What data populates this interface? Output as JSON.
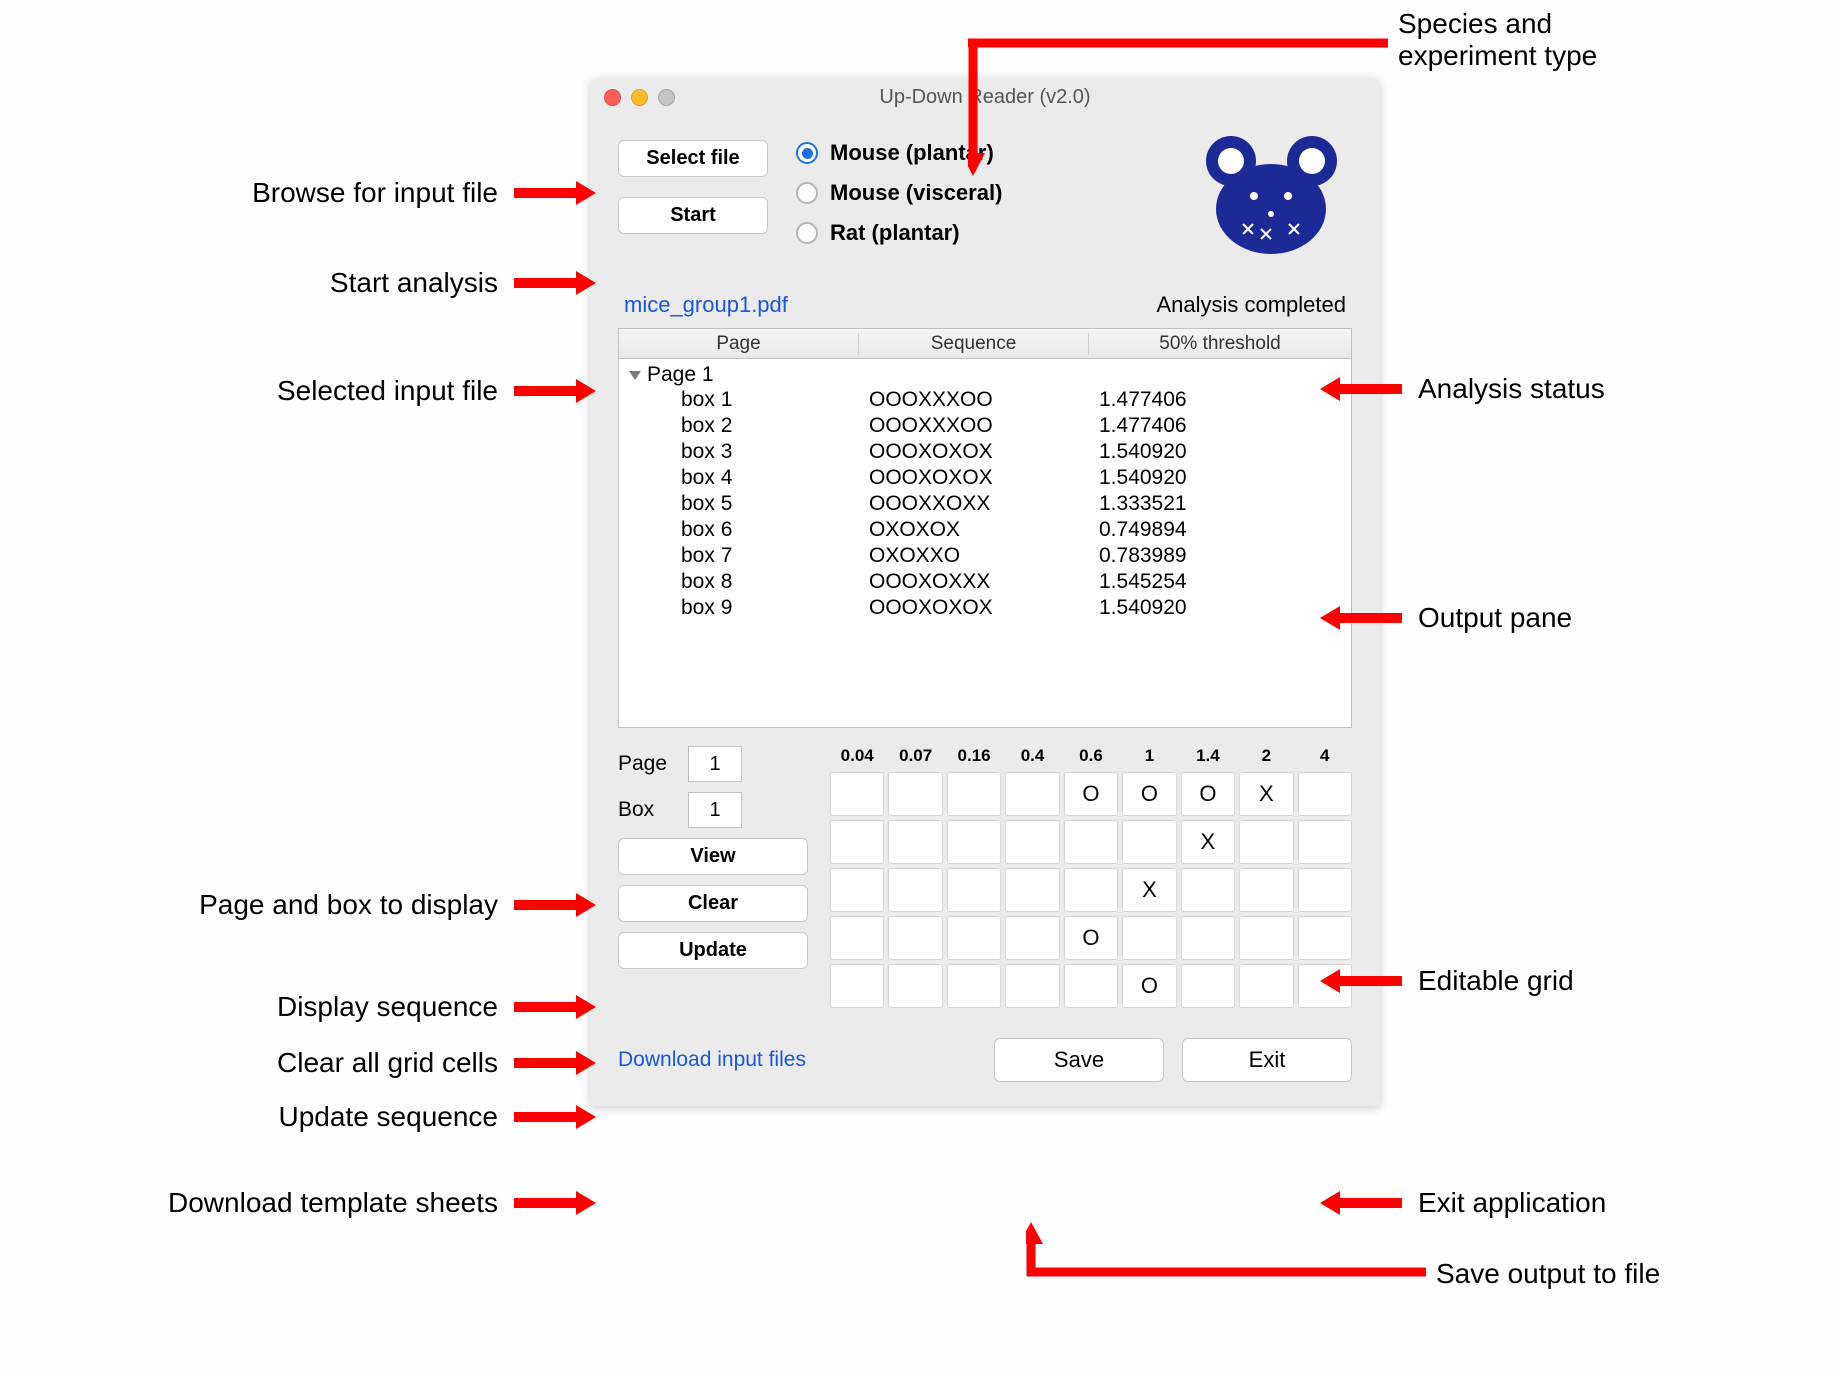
{
  "window": {
    "title": "Up-Down Reader (v2.0)"
  },
  "buttons": {
    "select_file": "Select file",
    "start": "Start",
    "view": "View",
    "clear": "Clear",
    "update": "Update",
    "save": "Save",
    "exit": "Exit"
  },
  "radios": {
    "mouse_plantar": "Mouse (plantar)",
    "mouse_visceral": "Mouse (visceral)",
    "rat_plantar": "Rat (plantar)"
  },
  "status": {
    "filename": "mice_group1.pdf",
    "analysis": "Analysis completed"
  },
  "table": {
    "headers": {
      "page": "Page",
      "sequence": "Sequence",
      "threshold": "50% threshold"
    },
    "page_group": "Page 1",
    "rows": [
      {
        "box": "box 1",
        "seq": "OOOXXXOO",
        "thresh": "1.477406"
      },
      {
        "box": "box 2",
        "seq": "OOOXXXOO",
        "thresh": "1.477406"
      },
      {
        "box": "box 3",
        "seq": "OOOXOXOX",
        "thresh": "1.540920"
      },
      {
        "box": "box 4",
        "seq": "OOOXOXOX",
        "thresh": "1.540920"
      },
      {
        "box": "box 5",
        "seq": "OOOXXOXX",
        "thresh": "1.333521"
      },
      {
        "box": "box 6",
        "seq": "OXOXOX",
        "thresh": "0.749894"
      },
      {
        "box": "box 7",
        "seq": "OXOXXO",
        "thresh": "0.783989"
      },
      {
        "box": "box 8",
        "seq": "OOOXOXXX",
        "thresh": "1.545254"
      },
      {
        "box": "box 9",
        "seq": "OOOXOXOX",
        "thresh": "1.540920"
      }
    ]
  },
  "fields": {
    "page_label": "Page",
    "box_label": "Box",
    "page_value": "1",
    "box_value": "1"
  },
  "grid": {
    "headers": [
      "0.04",
      "0.07",
      "0.16",
      "0.4",
      "0.6",
      "1",
      "1.4",
      "2",
      "4"
    ],
    "cells": [
      [
        "",
        "",
        "",
        "",
        "O",
        "O",
        "O",
        "X",
        ""
      ],
      [
        "",
        "",
        "",
        "",
        "",
        "",
        "X",
        "",
        ""
      ],
      [
        "",
        "",
        "",
        "",
        "",
        "X",
        "",
        "",
        ""
      ],
      [
        "",
        "",
        "",
        "",
        "O",
        "",
        "",
        "",
        ""
      ],
      [
        "",
        "",
        "",
        "",
        "",
        "O",
        "",
        "",
        ""
      ]
    ]
  },
  "links": {
    "download": "Download input files"
  },
  "annotations": {
    "browse": "Browse for input file",
    "start": "Start analysis",
    "selected_file": "Selected input file",
    "page_box": "Page and box to display",
    "display_seq": "Display sequence",
    "clear_grid": "Clear all grid cells",
    "update_seq": "Update sequence",
    "download": "Download template sheets",
    "species": "Species and\nexperiment type",
    "analysis_status": "Analysis status",
    "output_pane": "Output pane",
    "editable_grid": "Editable grid",
    "exit_app": "Exit application",
    "save_output": "Save output to file"
  }
}
